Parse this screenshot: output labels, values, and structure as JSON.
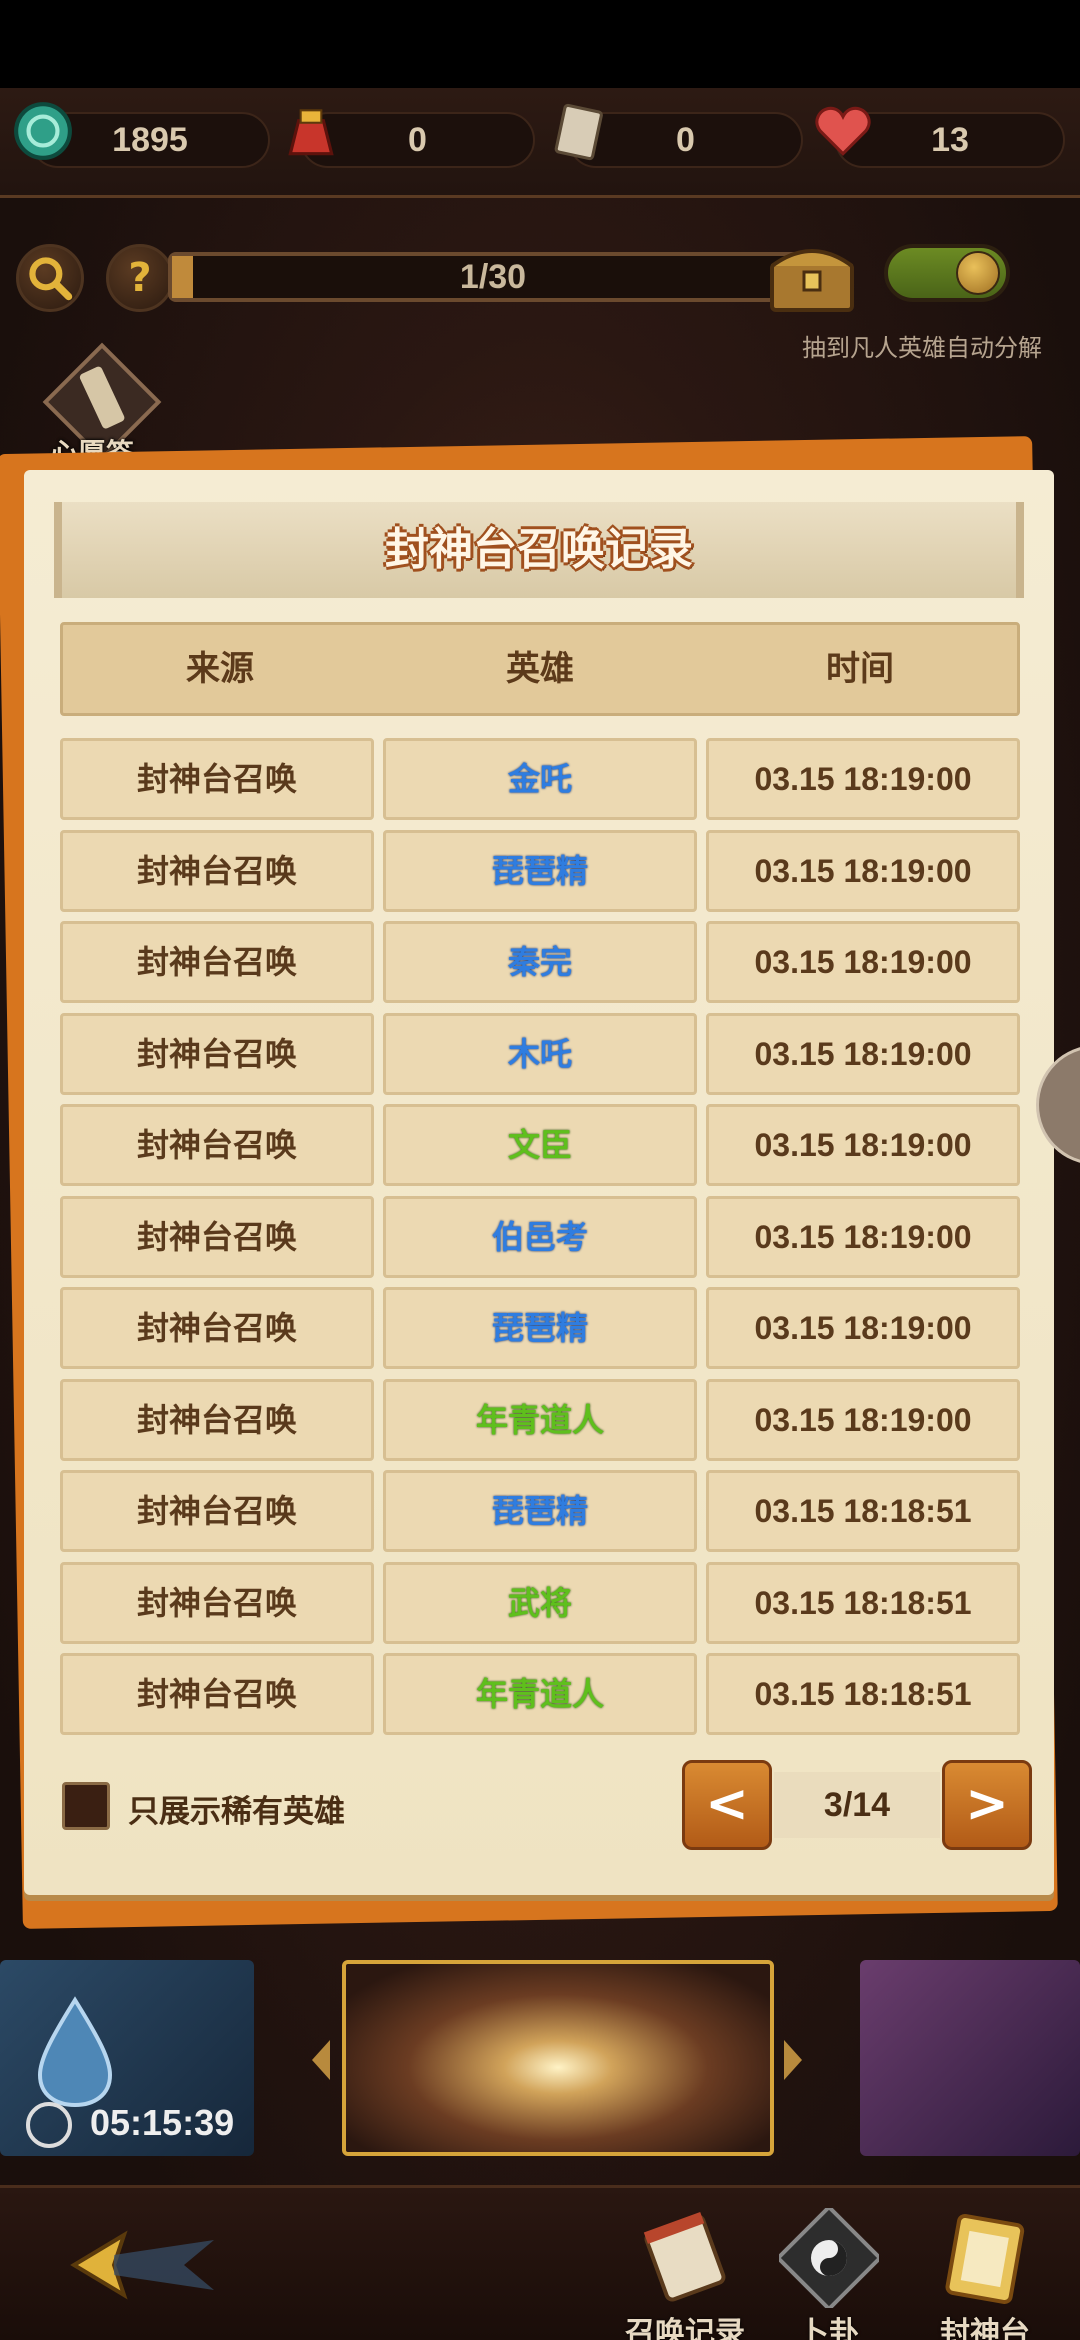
{
  "resources": [
    {
      "icon": "coin-icon",
      "value": "1895"
    },
    {
      "icon": "treasure-bag-icon",
      "value": "0"
    },
    {
      "icon": "ticket-icon",
      "value": "0"
    },
    {
      "icon": "heart-icon",
      "value": "13"
    }
  ],
  "top_controls": {
    "progress_text": "1/30",
    "progress_fraction": 0.033,
    "auto_decompose_label": "抽到凡人英雄自动分解",
    "auto_decompose_on": true,
    "wish_label": "心愿签"
  },
  "panel": {
    "title": "封神台召唤记录",
    "headers": [
      "来源",
      "英雄",
      "时间"
    ],
    "rows": [
      {
        "source": "封神台召唤",
        "hero": "金吒",
        "time": "03.15 18:19:00",
        "color": "blue"
      },
      {
        "source": "封神台召唤",
        "hero": "琵琶精",
        "time": "03.15 18:19:00",
        "color": "blue"
      },
      {
        "source": "封神台召唤",
        "hero": "秦完",
        "time": "03.15 18:19:00",
        "color": "blue"
      },
      {
        "source": "封神台召唤",
        "hero": "木吒",
        "time": "03.15 18:19:00",
        "color": "blue"
      },
      {
        "source": "封神台召唤",
        "hero": "文臣",
        "time": "03.15 18:19:00",
        "color": "green"
      },
      {
        "source": "封神台召唤",
        "hero": "伯邑考",
        "time": "03.15 18:19:00",
        "color": "blue"
      },
      {
        "source": "封神台召唤",
        "hero": "琵琶精",
        "time": "03.15 18:19:00",
        "color": "blue"
      },
      {
        "source": "封神台召唤",
        "hero": "年青道人",
        "time": "03.15 18:19:00",
        "color": "green"
      },
      {
        "source": "封神台召唤",
        "hero": "琵琶精",
        "time": "03.15 18:18:51",
        "color": "blue"
      },
      {
        "source": "封神台召唤",
        "hero": "武将",
        "time": "03.15 18:18:51",
        "color": "green"
      },
      {
        "source": "封神台召唤",
        "hero": "年青道人",
        "time": "03.15 18:18:51",
        "color": "green"
      }
    ],
    "rare_only_label": "只展示稀有英雄",
    "pager": {
      "prev": "<",
      "page": "3/14",
      "next": ">"
    }
  },
  "bottom": {
    "timer": "05:15:39",
    "nav": [
      {
        "label": "召唤记录",
        "icon": "scroll-record-icon"
      },
      {
        "label": "卜卦",
        "icon": "bagua-icon"
      },
      {
        "label": "封神台",
        "icon": "altar-scroll-icon"
      }
    ]
  },
  "colors": {
    "hero_blue": "#2f7de0",
    "hero_green": "#5fbf1d",
    "accent_orange": "#d7751e"
  }
}
